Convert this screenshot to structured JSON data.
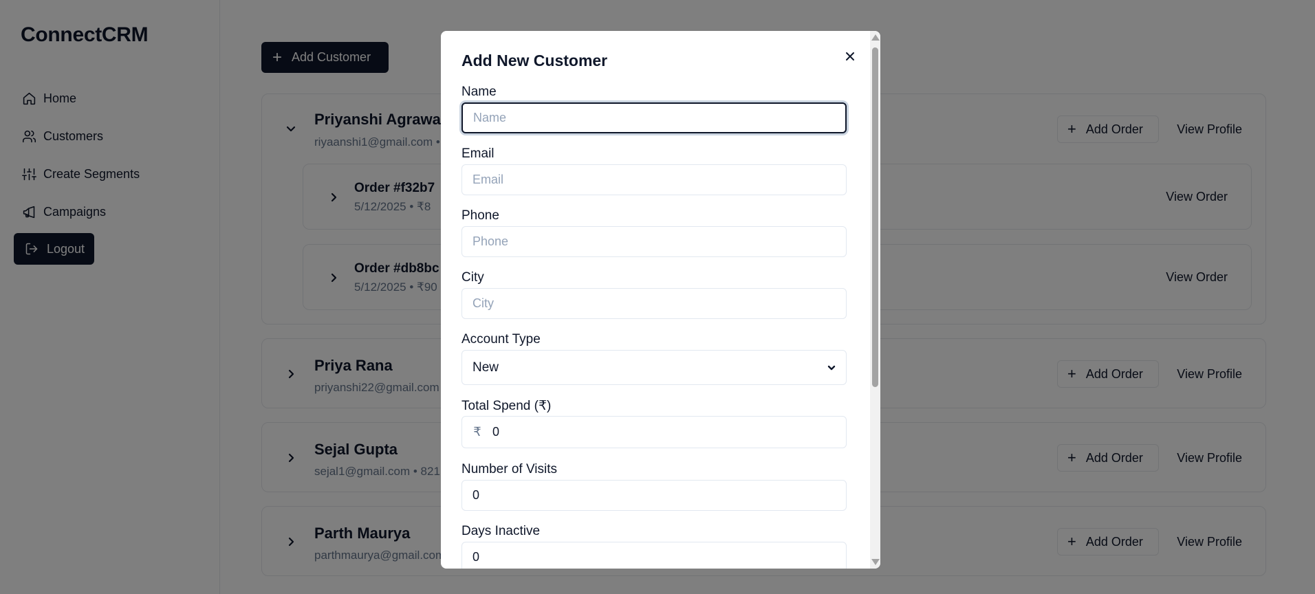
{
  "sidebar": {
    "brand": "ConnectCRM",
    "items": [
      {
        "label": "Home",
        "icon": "home-icon"
      },
      {
        "label": "Customers",
        "icon": "users-icon"
      },
      {
        "label": "Create Segments",
        "icon": "sliders-icon"
      },
      {
        "label": "Campaigns",
        "icon": "megaphone-icon"
      }
    ],
    "logout_label": "Logout"
  },
  "main": {
    "add_customer_label": "Add Customer",
    "add_order_label": "Add Order",
    "view_profile_label": "View Profile",
    "view_order_label": "View Order",
    "customers": [
      {
        "name": "Priyanshi Agrawal",
        "meta": "riyaanshi1@gmail.com •",
        "expanded": true,
        "orders": [
          {
            "title": "Order #f32b7",
            "meta": "5/12/2025 • ₹8"
          },
          {
            "title": "Order #db8bc",
            "meta": "5/12/2025 • ₹90"
          }
        ]
      },
      {
        "name": "Priya Rana",
        "meta": "priyanshi22@gmail.com",
        "expanded": false
      },
      {
        "name": "Sejal Gupta",
        "meta": "sejal1@gmail.com • 821",
        "expanded": false
      },
      {
        "name": "Parth Maurya",
        "meta": "parthmaurya@gmail.com",
        "expanded": false
      }
    ]
  },
  "modal": {
    "title": "Add New Customer",
    "fields": {
      "name": {
        "label": "Name",
        "placeholder": "Name",
        "value": ""
      },
      "email": {
        "label": "Email",
        "placeholder": "Email",
        "value": ""
      },
      "phone": {
        "label": "Phone",
        "placeholder": "Phone",
        "value": ""
      },
      "city": {
        "label": "City",
        "placeholder": "City",
        "value": ""
      },
      "account_type": {
        "label": "Account Type",
        "value": "New"
      },
      "total_spend": {
        "label": "Total Spend (₹)",
        "prefix": "₹",
        "value": "0"
      },
      "visits": {
        "label": "Number of Visits",
        "value": "0"
      },
      "days_inactive": {
        "label": "Days Inactive",
        "value": "0"
      }
    }
  },
  "colors": {
    "primary": "#0f172a",
    "muted_text": "#64748b",
    "border": "#e5e7eb",
    "overlay": "rgba(0,0,0,0.5)"
  }
}
